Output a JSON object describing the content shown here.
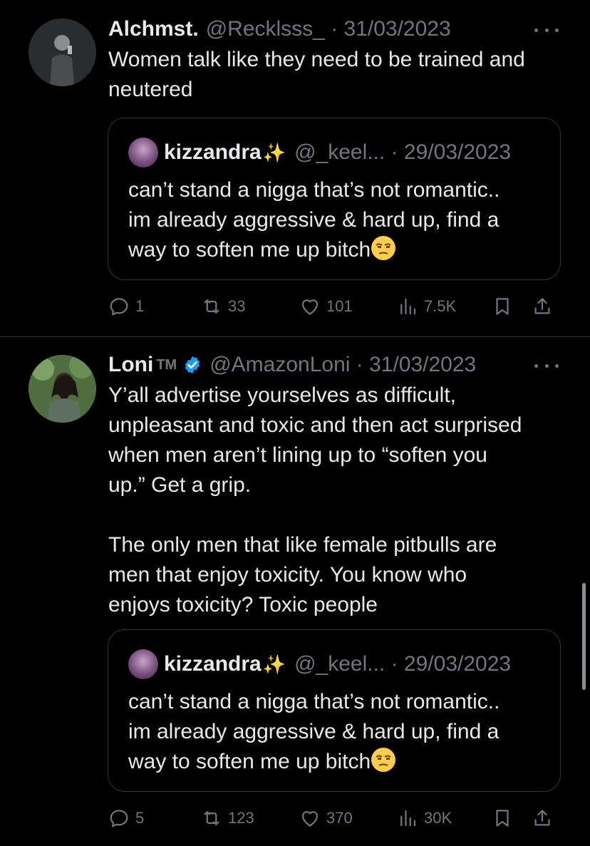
{
  "tweets": [
    {
      "author_name": "Alchmst.",
      "handle_date": "@Recklsss_ · 31/03/2023",
      "text_paragraphs": [
        "Women talk like they need to be trained and\nneutered"
      ],
      "quote": {
        "name": "kizzandra",
        "name_emoji": "✨",
        "handle_date": "@_keel... · 29/03/2023",
        "text": "can’t stand a nigga that’s not romantic..\nim already aggressive & hard up, find a\nway to soften me up bitch",
        "trailing_emoji": "unamused-face-icon"
      },
      "actions": {
        "replies": "1",
        "retweets": "33",
        "likes": "101",
        "views": "7.5K"
      }
    },
    {
      "author_name": "Loni",
      "author_badge": "TM",
      "verified": true,
      "handle_date": "@AmazonLoni · 31/03/2023",
      "text_paragraphs": [
        "Y’all advertise yourselves as difficult,\nunpleasant and toxic and then act surprised\nwhen men aren’t lining up to “soften you\nup.” Get a grip.",
        "The only men that like female pitbulls are\nmen that enjoy toxicity. You know who\nenjoys toxicity? Toxic people"
      ],
      "quote": {
        "name": "kizzandra",
        "name_emoji": "✨",
        "handle_date": "@_keel... · 29/03/2023",
        "text": "can’t stand a nigga that’s not romantic..\nim already aggressive & hard up, find a\nway to soften me up bitch",
        "trailing_emoji": "unamused-face-icon"
      },
      "actions": {
        "replies": "5",
        "retweets": "123",
        "likes": "370",
        "views": "30K"
      }
    }
  ],
  "colors": {
    "background": "#000000",
    "primary_text": "#e7e9ea",
    "secondary_text": "#71767b",
    "border": "#2f3336",
    "verified": "#1d9bf0",
    "sparkles": "#f7c948"
  }
}
